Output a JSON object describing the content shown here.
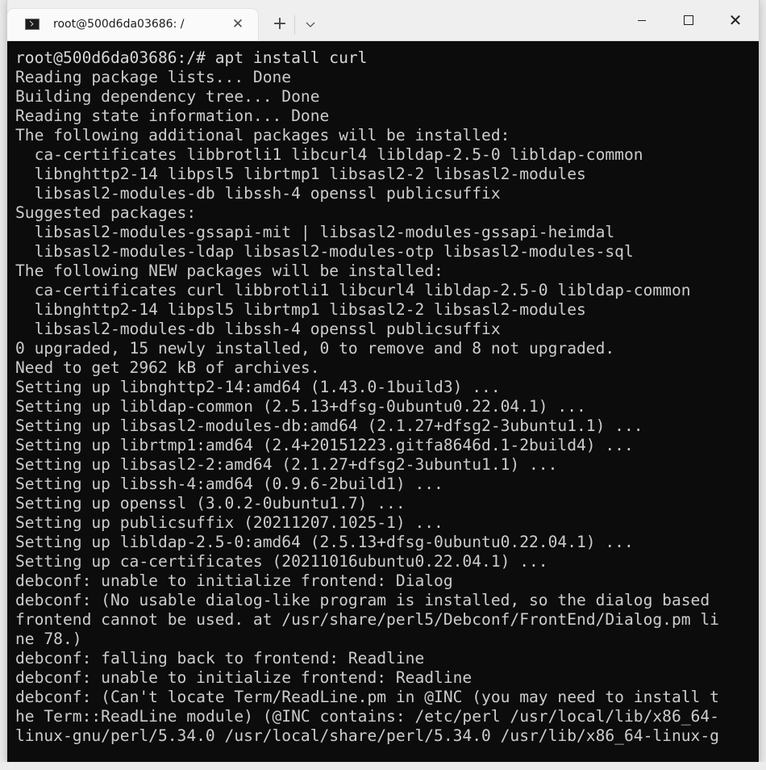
{
  "window": {
    "tab_title": "root@500d6da03686: /",
    "tab_close_icon": "close-icon",
    "new_tab_label": "+",
    "dropdown_icon": "chevron-down-icon",
    "minimize_icon": "minimize-icon",
    "maximize_icon": "maximize-icon",
    "close_icon": "close-icon"
  },
  "terminal": {
    "lines": [
      "root@500d6da03686:/# apt install curl",
      "Reading package lists... Done",
      "Building dependency tree... Done",
      "Reading state information... Done",
      "The following additional packages will be installed:",
      "  ca-certificates libbrotli1 libcurl4 libldap-2.5-0 libldap-common",
      "  libnghttp2-14 libpsl5 librtmp1 libsasl2-2 libsasl2-modules",
      "  libsasl2-modules-db libssh-4 openssl publicsuffix",
      "Suggested packages:",
      "  libsasl2-modules-gssapi-mit | libsasl2-modules-gssapi-heimdal",
      "  libsasl2-modules-ldap libsasl2-modules-otp libsasl2-modules-sql",
      "The following NEW packages will be installed:",
      "  ca-certificates curl libbrotli1 libcurl4 libldap-2.5-0 libldap-common",
      "  libnghttp2-14 libpsl5 librtmp1 libsasl2-2 libsasl2-modules",
      "  libsasl2-modules-db libssh-4 openssl publicsuffix",
      "0 upgraded, 15 newly installed, 0 to remove and 8 not upgraded.",
      "Need to get 2962 kB of archives.",
      "Setting up libnghttp2-14:amd64 (1.43.0-1build3) ...",
      "Setting up libldap-common (2.5.13+dfsg-0ubuntu0.22.04.1) ...",
      "Setting up libsasl2-modules-db:amd64 (2.1.27+dfsg2-3ubuntu1.1) ...",
      "Setting up librtmp1:amd64 (2.4+20151223.gitfa8646d.1-2build4) ...",
      "Setting up libsasl2-2:amd64 (2.1.27+dfsg2-3ubuntu1.1) ...",
      "Setting up libssh-4:amd64 (0.9.6-2build1) ...",
      "Setting up openssl (3.0.2-0ubuntu1.7) ...",
      "Setting up publicsuffix (20211207.1025-1) ...",
      "Setting up libldap-2.5-0:amd64 (2.5.13+dfsg-0ubuntu0.22.04.1) ...",
      "Setting up ca-certificates (20211016ubuntu0.22.04.1) ...",
      "debconf: unable to initialize frontend: Dialog",
      "debconf: (No usable dialog-like program is installed, so the dialog based",
      "frontend cannot be used. at /usr/share/perl5/Debconf/FrontEnd/Dialog.pm li",
      "ne 78.)",
      "debconf: falling back to frontend: Readline",
      "debconf: unable to initialize frontend: Readline",
      "debconf: (Can't locate Term/ReadLine.pm in @INC (you may need to install t",
      "he Term::ReadLine module) (@INC contains: /etc/perl /usr/local/lib/x86_64-",
      "linux-gnu/perl/5.34.0 /usr/local/share/perl/5.34.0 /usr/lib/x86_64-linux-g"
    ]
  },
  "colors": {
    "terminal_bg": "#0c0c0c",
    "terminal_text": "#cccccc",
    "titlebar_bg": "#efefef"
  }
}
